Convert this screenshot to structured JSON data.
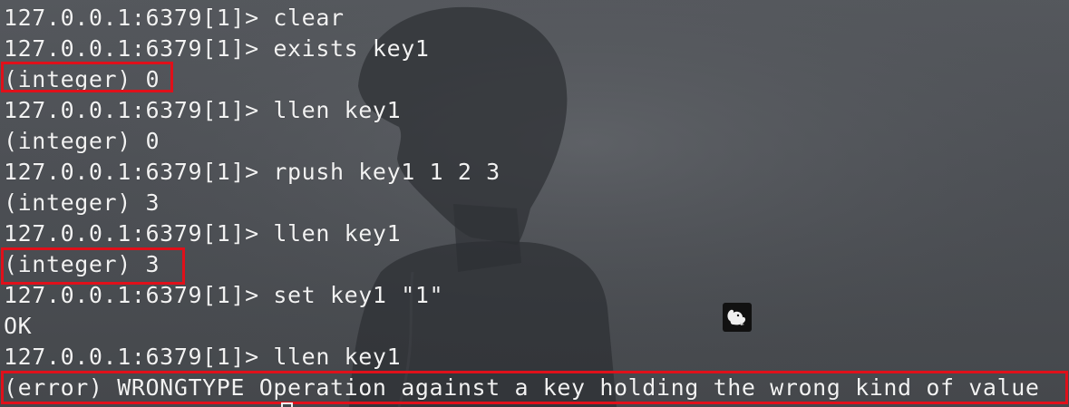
{
  "terminal": {
    "lines": [
      "127.0.0.1:6379[1]> clear",
      "127.0.0.1:6379[1]> exists key1",
      "(integer) 0",
      "127.0.0.1:6379[1]> llen key1",
      "(integer) 0",
      "127.0.0.1:6379[1]> rpush key1 1 2 3",
      "(integer) 3",
      "127.0.0.1:6379[1]> llen key1",
      "(integer) 3",
      "127.0.0.1:6379[1]> set key1 \"1\"",
      "OK",
      "127.0.0.1:6379[1]> llen key1",
      "(error) WRONGTYPE Operation against a key holding the wrong kind of value"
    ]
  },
  "colors": {
    "text": "#f2f2f2",
    "highlight": "#e0101a",
    "background": "#4c4f54"
  },
  "icons": {
    "tray": "squirrel-app-icon"
  }
}
